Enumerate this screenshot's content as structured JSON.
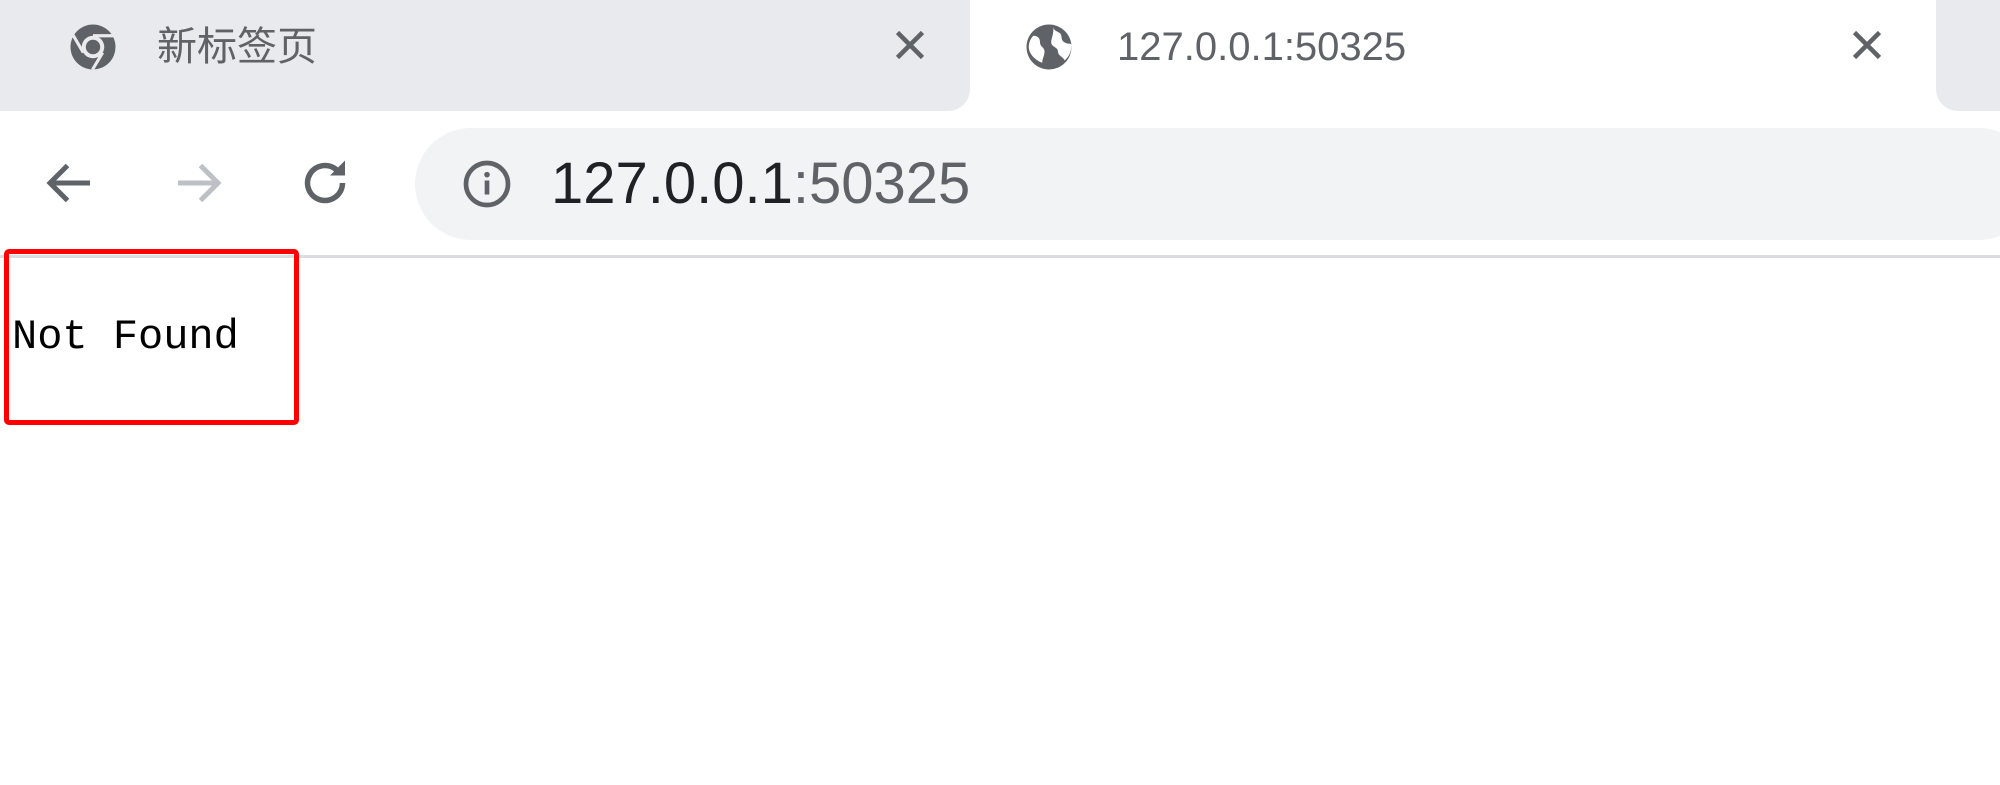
{
  "tabs": [
    {
      "title": "新标签页",
      "icon": "chrome-icon",
      "active": false
    },
    {
      "title": "127.0.0.1:50325",
      "icon": "globe-icon",
      "active": true
    }
  ],
  "toolbar": {
    "url_host": "127.0.0.1",
    "url_port": ":50325",
    "security_icon": "info-icon"
  },
  "page": {
    "message": "Not Found"
  },
  "colors": {
    "highlight": "#ff0000",
    "tab_inactive": "#e8eaed",
    "omnibox": "#f1f3f4"
  }
}
